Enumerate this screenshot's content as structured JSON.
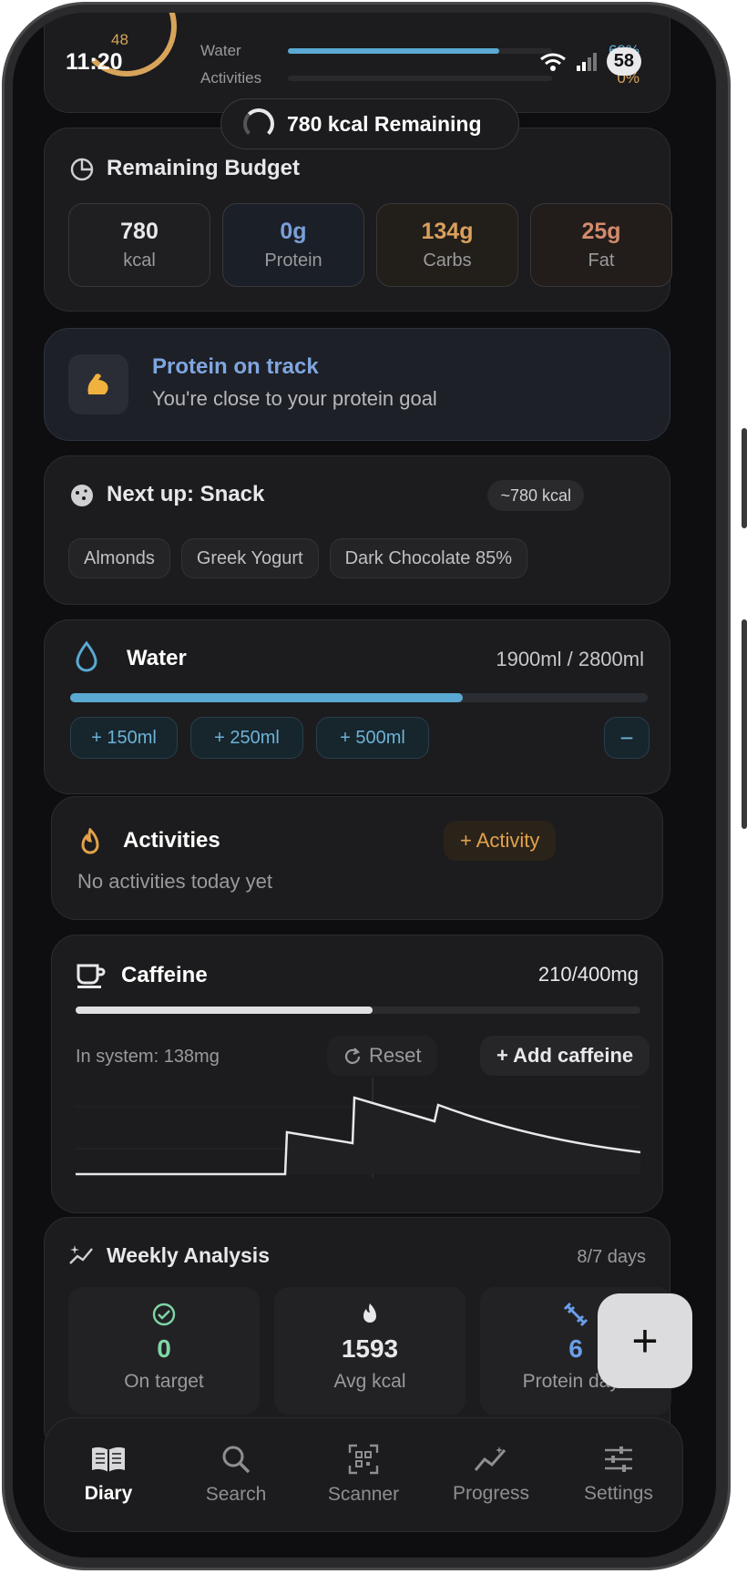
{
  "status_bar": {
    "time": "11:20",
    "battery": "58"
  },
  "summary_mini": {
    "ring_value": "48",
    "rows": [
      {
        "label": "Water",
        "fill": 0.8,
        "pct": "68%"
      },
      {
        "label": "Activities",
        "fill": 0.0,
        "pct": "0%"
      }
    ]
  },
  "remaining_pill": "780 kcal Remaining",
  "budget": {
    "title": "Remaining Budget",
    "items": [
      {
        "value": "780",
        "label": "kcal",
        "color": "#e8e8ea",
        "bg": "#1f1f21"
      },
      {
        "value": "0g",
        "label": "Protein",
        "color": "#7a9fd8",
        "bg": "#1b1f27"
      },
      {
        "value": "134g",
        "label": "Carbs",
        "color": "#d9a05e",
        "bg": "#221e19"
      },
      {
        "value": "25g",
        "label": "Fat",
        "color": "#d28a6c",
        "bg": "#221c1a"
      }
    ]
  },
  "insight": {
    "title": "Protein on track",
    "subtitle": "You're close to your protein goal"
  },
  "next_up": {
    "title": "Next up: Snack",
    "kcal": "~780 kcal",
    "items": [
      "Almonds",
      "Greek Yogurt",
      "Dark Chocolate 85%"
    ]
  },
  "water": {
    "title": "Water",
    "amount": "1900ml / 2800ml",
    "progress": 0.68,
    "buttons": [
      "+ 150ml",
      "+ 250ml",
      "+ 500ml"
    ],
    "minus": "−"
  },
  "activities": {
    "title": "Activities",
    "add_label": "+ Activity",
    "empty_text": "No activities today yet"
  },
  "caffeine": {
    "title": "Caffeine",
    "amount": "210/400mg",
    "progress": 0.525,
    "in_system": "In system: 138mg",
    "reset_label": "Reset",
    "add_label": "+ Add caffeine"
  },
  "weekly": {
    "title": "Weekly Analysis",
    "days": "8/7 days",
    "stats": [
      {
        "value": "0",
        "label": "On target",
        "color": "#7fd6a6"
      },
      {
        "value": "1593",
        "label": "Avg kcal",
        "color": "#e8e8ea"
      },
      {
        "value": "6",
        "label": "Protein days",
        "color": "#6b9ee8"
      }
    ]
  },
  "nav": [
    {
      "label": "Diary",
      "icon": "book-icon",
      "active": true
    },
    {
      "label": "Search",
      "icon": "search-icon",
      "active": false
    },
    {
      "label": "Scanner",
      "icon": "qr-scanner-icon",
      "active": false
    },
    {
      "label": "Progress",
      "icon": "progress-icon",
      "active": false
    },
    {
      "label": "Settings",
      "icon": "sliders-icon",
      "active": false
    }
  ],
  "fab_label": "+"
}
